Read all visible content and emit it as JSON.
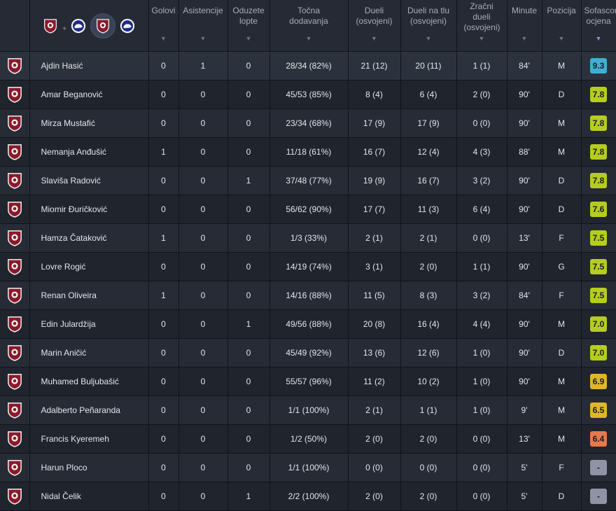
{
  "header": {
    "team_filter": {
      "plus": "+",
      "icons": [
        "team-sarajevo-icon",
        "team-opponent-icon",
        "team-sarajevo-icon",
        "team-opponent-icon"
      ]
    },
    "columns": [
      "Golovi",
      "Asistencije",
      "Oduzete lopte",
      "Točna dodavanja",
      "Dueli (osvojeni)",
      "Dueli na tlu (osvojeni)",
      "Zračni dueli (osvojeni)",
      "Minute",
      "Pozicija",
      "Sofascore ocjena"
    ],
    "sort_arrow": "▼"
  },
  "rating_colors": {
    "9": "#3fb0d3",
    "7.5": "#b6cc1e",
    "6.9": "#e0b52a",
    "6.4": "#e8794a",
    "none": "#8e94a3"
  },
  "players": [
    {
      "name": "Ajdin Hasić",
      "goals": "0",
      "assists": "1",
      "tackles": "0",
      "passes": "28/34 (82%)",
      "duels": "21 (12)",
      "ground": "20 (11)",
      "aerial": "1 (1)",
      "minutes": "84'",
      "position": "M",
      "rating": "9.3"
    },
    {
      "name": "Amar Beganović",
      "goals": "0",
      "assists": "0",
      "tackles": "0",
      "passes": "45/53 (85%)",
      "duels": "8 (4)",
      "ground": "6 (4)",
      "aerial": "2 (0)",
      "minutes": "90'",
      "position": "D",
      "rating": "7.8"
    },
    {
      "name": "Mirza Mustafić",
      "goals": "0",
      "assists": "0",
      "tackles": "0",
      "passes": "23/34 (68%)",
      "duels": "17 (9)",
      "ground": "17 (9)",
      "aerial": "0 (0)",
      "minutes": "90'",
      "position": "M",
      "rating": "7.8"
    },
    {
      "name": "Nemanja Anđušić",
      "goals": "1",
      "assists": "0",
      "tackles": "0",
      "passes": "11/18 (61%)",
      "duels": "16 (7)",
      "ground": "12 (4)",
      "aerial": "4 (3)",
      "minutes": "88'",
      "position": "M",
      "rating": "7.8"
    },
    {
      "name": "Slaviša Radović",
      "goals": "0",
      "assists": "0",
      "tackles": "1",
      "passes": "37/48 (77%)",
      "duels": "19 (9)",
      "ground": "16 (7)",
      "aerial": "3 (2)",
      "minutes": "90'",
      "position": "D",
      "rating": "7.8"
    },
    {
      "name": "Miomir Đuričković",
      "goals": "0",
      "assists": "0",
      "tackles": "0",
      "passes": "56/62 (90%)",
      "duels": "17 (7)",
      "ground": "11 (3)",
      "aerial": "6 (4)",
      "minutes": "90'",
      "position": "D",
      "rating": "7.6"
    },
    {
      "name": "Hamza Čataković",
      "goals": "1",
      "assists": "0",
      "tackles": "0",
      "passes": "1/3 (33%)",
      "duels": "2 (1)",
      "ground": "2 (1)",
      "aerial": "0 (0)",
      "minutes": "13'",
      "position": "F",
      "rating": "7.5"
    },
    {
      "name": "Lovre Rogić",
      "goals": "0",
      "assists": "0",
      "tackles": "0",
      "passes": "14/19 (74%)",
      "duels": "3 (1)",
      "ground": "2 (0)",
      "aerial": "1 (1)",
      "minutes": "90'",
      "position": "G",
      "rating": "7.5"
    },
    {
      "name": "Renan Oliveira",
      "goals": "1",
      "assists": "0",
      "tackles": "0",
      "passes": "14/16 (88%)",
      "duels": "11 (5)",
      "ground": "8 (3)",
      "aerial": "3 (2)",
      "minutes": "84'",
      "position": "F",
      "rating": "7.5"
    },
    {
      "name": "Edin Julardžija",
      "goals": "0",
      "assists": "0",
      "tackles": "1",
      "passes": "49/56 (88%)",
      "duels": "20 (8)",
      "ground": "16 (4)",
      "aerial": "4 (4)",
      "minutes": "90'",
      "position": "M",
      "rating": "7.0"
    },
    {
      "name": "Marin Aničić",
      "goals": "0",
      "assists": "0",
      "tackles": "0",
      "passes": "45/49 (92%)",
      "duels": "13 (6)",
      "ground": "12 (6)",
      "aerial": "1 (0)",
      "minutes": "90'",
      "position": "D",
      "rating": "7.0"
    },
    {
      "name": "Muhamed Buljubašić",
      "goals": "0",
      "assists": "0",
      "tackles": "0",
      "passes": "55/57 (96%)",
      "duels": "11 (2)",
      "ground": "10 (2)",
      "aerial": "1 (0)",
      "minutes": "90'",
      "position": "M",
      "rating": "6.9"
    },
    {
      "name": "Adalberto Peñaranda",
      "goals": "0",
      "assists": "0",
      "tackles": "0",
      "passes": "1/1 (100%)",
      "duels": "2 (1)",
      "ground": "1 (1)",
      "aerial": "1 (0)",
      "minutes": "9'",
      "position": "M",
      "rating": "6.5"
    },
    {
      "name": "Francis Kyeremeh",
      "goals": "0",
      "assists": "0",
      "tackles": "0",
      "passes": "1/2 (50%)",
      "duels": "2 (0)",
      "ground": "2 (0)",
      "aerial": "0 (0)",
      "minutes": "13'",
      "position": "M",
      "rating": "6.4"
    },
    {
      "name": "Harun Ploco",
      "goals": "0",
      "assists": "0",
      "tackles": "0",
      "passes": "1/1 (100%)",
      "duels": "0 (0)",
      "ground": "0 (0)",
      "aerial": "0 (0)",
      "minutes": "5'",
      "position": "F",
      "rating": "-"
    },
    {
      "name": "Nidal Čelik",
      "goals": "0",
      "assists": "0",
      "tackles": "1",
      "passes": "2/2 (100%)",
      "duels": "2 (0)",
      "ground": "2 (0)",
      "aerial": "0 (0)",
      "minutes": "5'",
      "position": "D",
      "rating": "-"
    }
  ]
}
